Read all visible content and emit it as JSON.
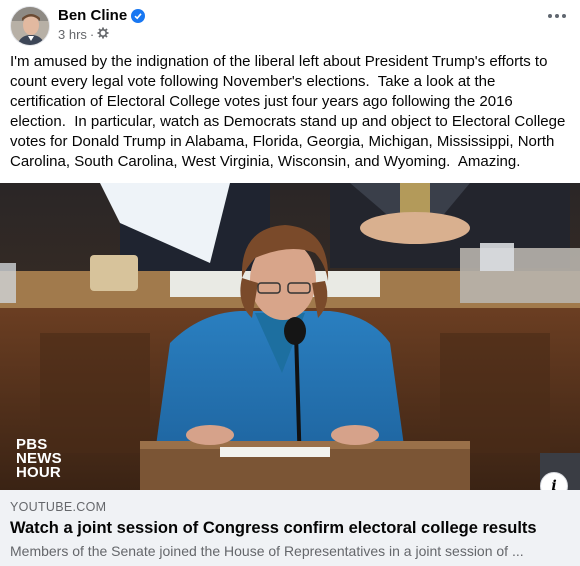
{
  "post": {
    "author": "Ben Cline",
    "verified_icon": "verified-badge-icon",
    "time": "3 hrs",
    "separator": "·",
    "audience_icon": "gear-icon",
    "more_icon": "more-options-icon",
    "text": "I'm amused by the indignation of the liberal left about President Trump's efforts to count every legal vote following November's elections.  Take a look at the certification of Electoral College votes just four years ago following the 2016 election.  In particular, watch as Democrats stand up and object to Electoral College votes for Donald Trump in Alabama, Florida, Georgia, Michigan, Mississippi, North Carolina, South Carolina, West Virginia, Wisconsin, and Wyoming.  Amazing."
  },
  "media": {
    "logo_line1": "PBS",
    "logo_line2": "NEWS",
    "logo_line3": "HOUR",
    "info_label": "i"
  },
  "link": {
    "domain": "YOUTUBE.COM",
    "title": "Watch a joint session of Congress confirm electoral college results",
    "description": "Members of the Senate joined the House of Representatives in a joint session of ..."
  },
  "colors": {
    "accent": "#1877f2",
    "secondary_text": "#65676b",
    "card_background": "#f0f2f5"
  }
}
